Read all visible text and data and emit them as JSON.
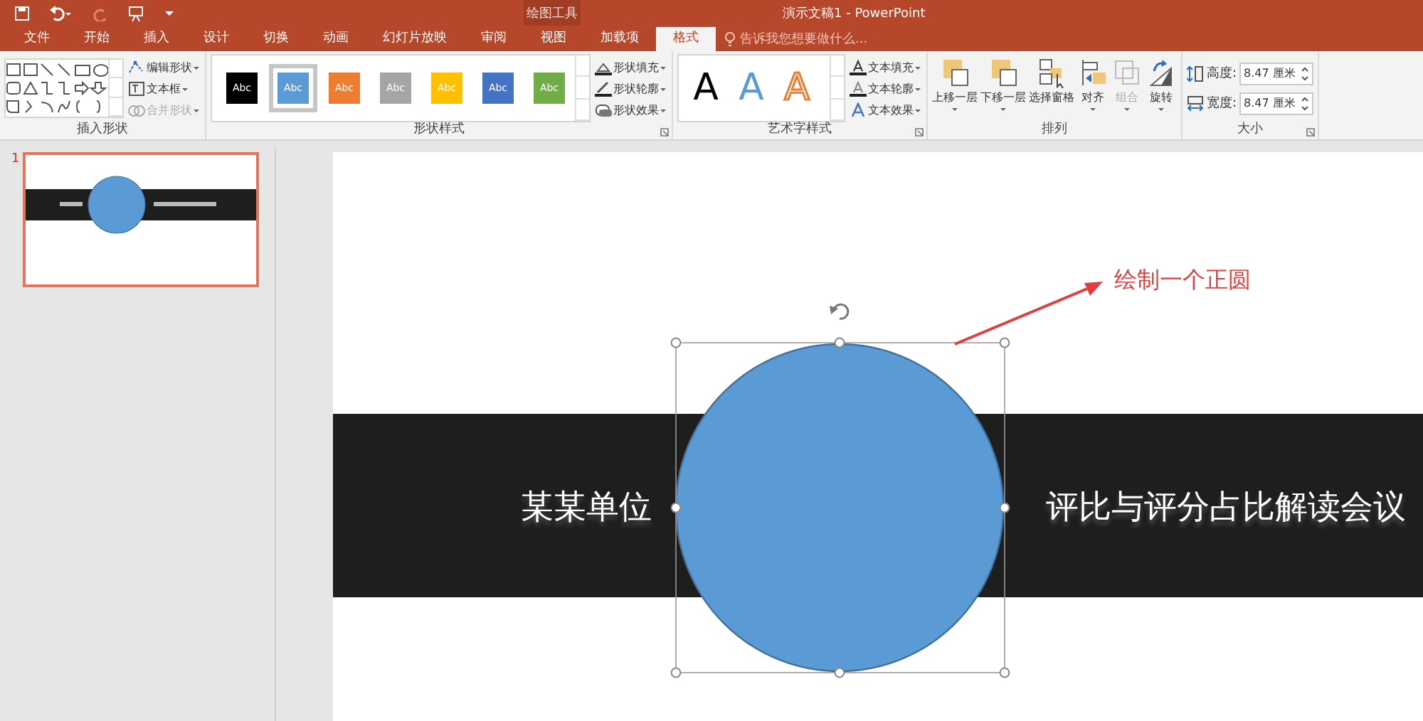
{
  "title_bar": {
    "context_group": "绘图工具",
    "title": "演示文稿1 - PowerPoint"
  },
  "tabs": [
    {
      "label": "文件",
      "selected": false
    },
    {
      "label": "开始",
      "selected": false
    },
    {
      "label": "插入",
      "selected": false
    },
    {
      "label": "设计",
      "selected": false
    },
    {
      "label": "切换",
      "selected": false
    },
    {
      "label": "动画",
      "selected": false
    },
    {
      "label": "幻灯片放映",
      "selected": false
    },
    {
      "label": "审阅",
      "selected": false
    },
    {
      "label": "视图",
      "selected": false
    },
    {
      "label": "加载项",
      "selected": false
    },
    {
      "label": "格式",
      "selected": true
    }
  ],
  "tell_me": {
    "placeholder": "告诉我您想要做什么..."
  },
  "insert_shapes": {
    "label": "插入形状",
    "commands": [
      {
        "label": "编辑形状",
        "disabled": false
      },
      {
        "label": "文本框",
        "disabled": false
      },
      {
        "label": "合并形状",
        "disabled": true
      }
    ]
  },
  "shape_styles": {
    "label": "形状样式",
    "presets": [
      {
        "label": "Abc",
        "color": "#000000",
        "selected": false
      },
      {
        "label": "Abc",
        "color": "#5b9bd5",
        "selected": true
      },
      {
        "label": "Abc",
        "color": "#ed7d31",
        "selected": false
      },
      {
        "label": "Abc",
        "color": "#a5a5a5",
        "selected": false
      },
      {
        "label": "Abc",
        "color": "#ffc000",
        "selected": false
      },
      {
        "label": "Abc",
        "color": "#4472c4",
        "selected": false
      },
      {
        "label": "Abc",
        "color": "#70ad47",
        "selected": false
      }
    ],
    "commands": [
      "形状填充",
      "形状轮廓",
      "形状效果"
    ]
  },
  "wordart_styles": {
    "label": "艺术字样式",
    "presets": [
      {
        "label": "A",
        "kind": "plain"
      },
      {
        "label": "A",
        "kind": "blue"
      },
      {
        "label": "A",
        "kind": "outline"
      }
    ],
    "commands": [
      "文本填充",
      "文本轮廓",
      "文本效果"
    ]
  },
  "arrange": {
    "label": "排列",
    "commands": [
      {
        "label": "上移一层",
        "disabled": false
      },
      {
        "label": "下移一层",
        "disabled": false
      },
      {
        "label": "选择窗格",
        "disabled": false
      },
      {
        "label": "对齐",
        "disabled": false
      },
      {
        "label": "组合",
        "disabled": true
      },
      {
        "label": "旋转",
        "disabled": false
      }
    ]
  },
  "size": {
    "label": "大小",
    "fields": [
      {
        "label": "高度:",
        "value": "8.47 厘米"
      },
      {
        "label": "宽度:",
        "value": "8.47 厘米"
      }
    ]
  },
  "slides": [
    {
      "number": "1",
      "selected": true
    }
  ],
  "slide": {
    "left_text": "某某单位",
    "right_text": "评比与评分占比解读会议",
    "annotation": "绘制一个正圆"
  }
}
